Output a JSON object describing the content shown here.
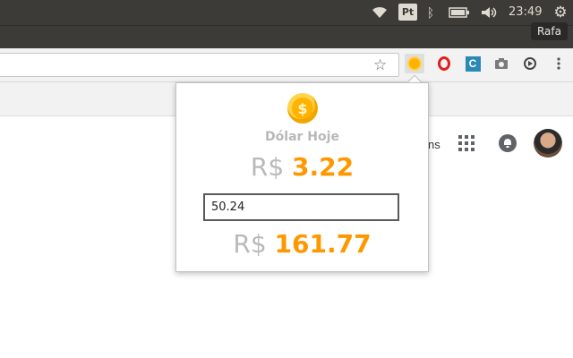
{
  "system_tray": {
    "keyboard_layout": "Pt",
    "clock": "23:49",
    "user": "Rafa",
    "icons": [
      "wifi-icon",
      "bluetooth-icon",
      "battery-icon",
      "volume-icon",
      "settings-gear-icon"
    ]
  },
  "browser": {
    "toolbar_icons": [
      "bookmark-star-icon",
      "dolar-hoje-coin-icon",
      "opera-icon",
      "wave-extension-icon",
      "camera-icon",
      "sync-icon",
      "more-vert-icon"
    ]
  },
  "page": {
    "header_link_text": "ns"
  },
  "popup": {
    "title": "Dólar Hoje",
    "rate_currency": "R$",
    "rate_value": "3.22",
    "input_value": "50.24",
    "result_currency": "R$",
    "result_value": "161.77",
    "coin_symbol": "$",
    "colors": {
      "accent": "#ff9800",
      "muted": "#b9b9b9"
    }
  }
}
